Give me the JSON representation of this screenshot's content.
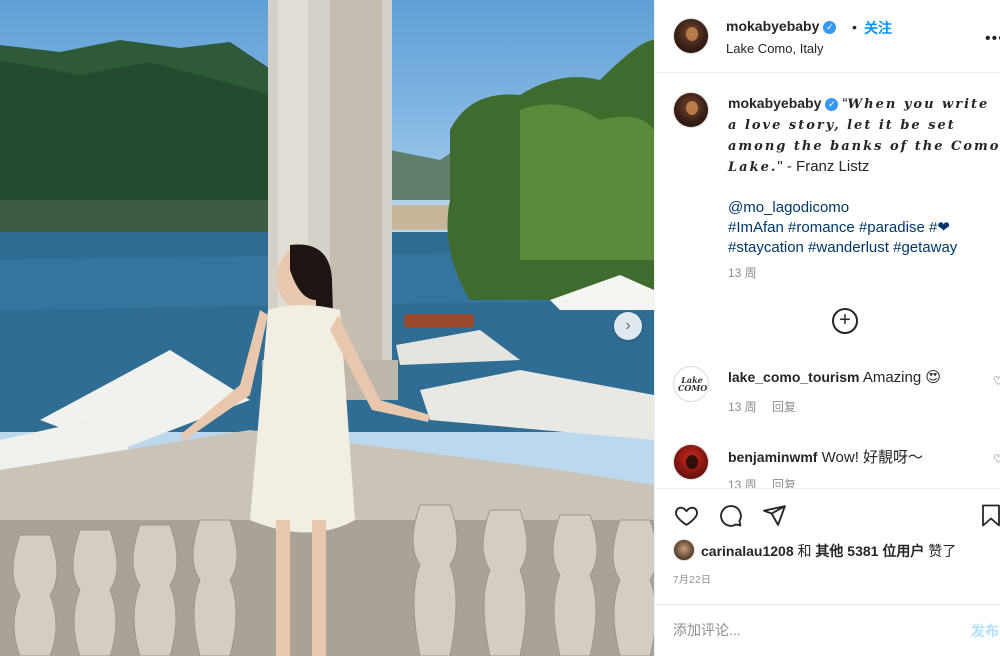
{
  "post": {
    "username": "mokabyebaby",
    "follow_label": "关注",
    "dot": "•",
    "location": "Lake Como, Italy",
    "more_icon": "more-horizontal-icon",
    "verified_icon": "verified-badge-icon"
  },
  "caption": {
    "username": "mokabyebaby",
    "quote_open": "“",
    "quote": "When you write a love story, let it be set among the banks of the Como Lake.",
    "quote_close": "\" - Franz Listz",
    "mention": "@mo_lagodicomo",
    "tags_line1": "#ImAfan #romance #paradise #",
    "heart": "❤",
    "tags_line2": "#staycation #wanderlust #getaway",
    "time": "13 周"
  },
  "comments": [
    {
      "username": "lake_como_tourism",
      "text": "Amazing",
      "emoji": "😍",
      "time": "13 周",
      "reply": "回复",
      "avatar_text": "Lake COMO"
    },
    {
      "username": "benjaminwmf",
      "text": "Wow! 好靚呀～",
      "time": "13 周",
      "reply": "回复"
    }
  ],
  "actions": {
    "liked_by_user": "carinalau1208",
    "liked_by_mid": "和",
    "liked_by_others": "其他 5381 位用户",
    "liked_by_end": "赞了",
    "date": "7月22日"
  },
  "comment_box": {
    "placeholder": "添加评论...",
    "post_label": "发布"
  },
  "colors": {
    "accent": "#0095f6",
    "link": "#00376b",
    "muted": "#8e8e8e"
  }
}
